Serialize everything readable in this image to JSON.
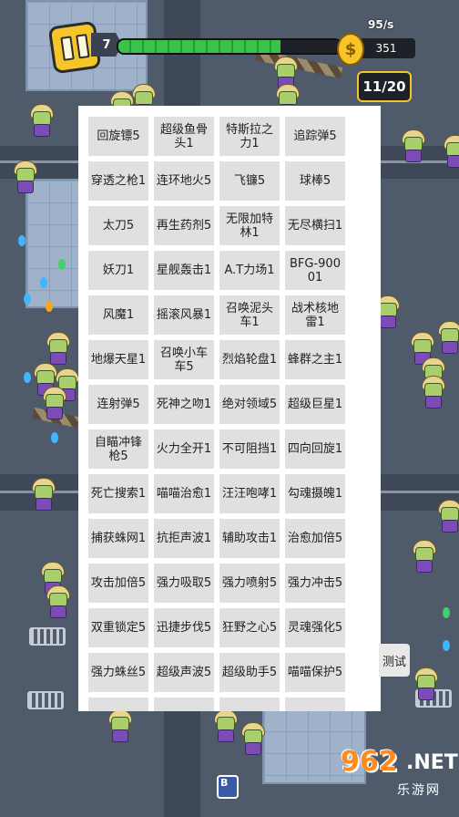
{
  "hud": {
    "level": "7",
    "xp_progress": 0.73,
    "rate": "95/s",
    "coins": "351",
    "coin_symbol": "$",
    "wave": "11/20"
  },
  "skills": [
    "回旋镖5",
    "超级鱼骨头1",
    "特斯拉之力1",
    "追踪弹5",
    "穿透之枪1",
    "连环地火5",
    "飞镰5",
    "球棒5",
    "太刀5",
    "再生药剂5",
    "无限加特林1",
    "无尽横扫1",
    "妖刀1",
    "星舰轰击1",
    "A.T力场1",
    "BFG-90001",
    "风魔1",
    "摇滚风暴1",
    "召唤泥头车1",
    "战术核地雷1",
    "地爆天星1",
    "召唤小车车5",
    "烈焰轮盘1",
    "蜂群之主1",
    "连射弹5",
    "死神之吻1",
    "绝对领域5",
    "超级巨星1",
    "自瞄冲锋枪5",
    "火力全开1",
    "不可阻挡1",
    "四向回旋1",
    "死亡搜索1",
    "喵喵治愈1",
    "汪汪咆哮1",
    "勾魂摄魄1",
    "捕获蛛网1",
    "抗拒声波1",
    "辅助攻击1",
    "治愈加倍5",
    "攻击加倍5",
    "强力吸取5",
    "强力喷射5",
    "强力冲击5",
    "双重锁定5",
    "迅捷步伐5",
    "狂野之心5",
    "灵魂强化5",
    "强力蛛丝5",
    "超级声波5",
    "超级助手5",
    "喵喵保护5",
    "",
    "",
    "",
    ""
  ],
  "test_button": "测试",
  "bottom_icon": "B",
  "watermark": {
    "main": "962",
    "net": ".NET",
    "sub": "乐游网"
  },
  "colors": {
    "accent": "#f5c52a",
    "xp": "#39c34a"
  }
}
